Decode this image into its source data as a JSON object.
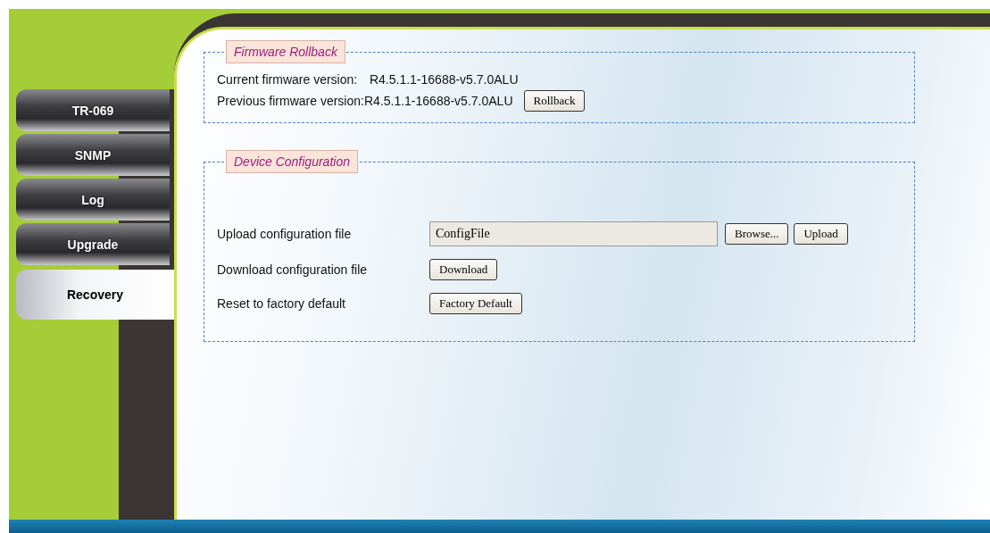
{
  "sidebar": {
    "items": [
      {
        "label": "TR-069",
        "selected": false
      },
      {
        "label": "SNMP",
        "selected": false
      },
      {
        "label": "Log",
        "selected": false
      },
      {
        "label": "Upgrade",
        "selected": false
      },
      {
        "label": "Recovery",
        "selected": true
      }
    ]
  },
  "firmware_rollback": {
    "title": "Firmware Rollback",
    "current_label": "Current firmware version:",
    "current_value": "R4.5.1.1-16688-v5.7.0ALU",
    "previous_label": "Previous firmware version:",
    "previous_value": "R4.5.1.1-16688-v5.7.0ALU",
    "rollback_button": "Rollback"
  },
  "device_configuration": {
    "title": "Device Configuration",
    "rows": [
      {
        "kind": "upload",
        "label": "Upload configuration file",
        "file_value": "ConfigFile",
        "buttons": [
          "Browse...",
          "Upload"
        ]
      },
      {
        "kind": "button",
        "label": "Download configuration file",
        "buttons": [
          "Download"
        ]
      },
      {
        "kind": "button",
        "label": "Reset to factory default",
        "buttons": [
          "Factory Default"
        ]
      }
    ]
  }
}
